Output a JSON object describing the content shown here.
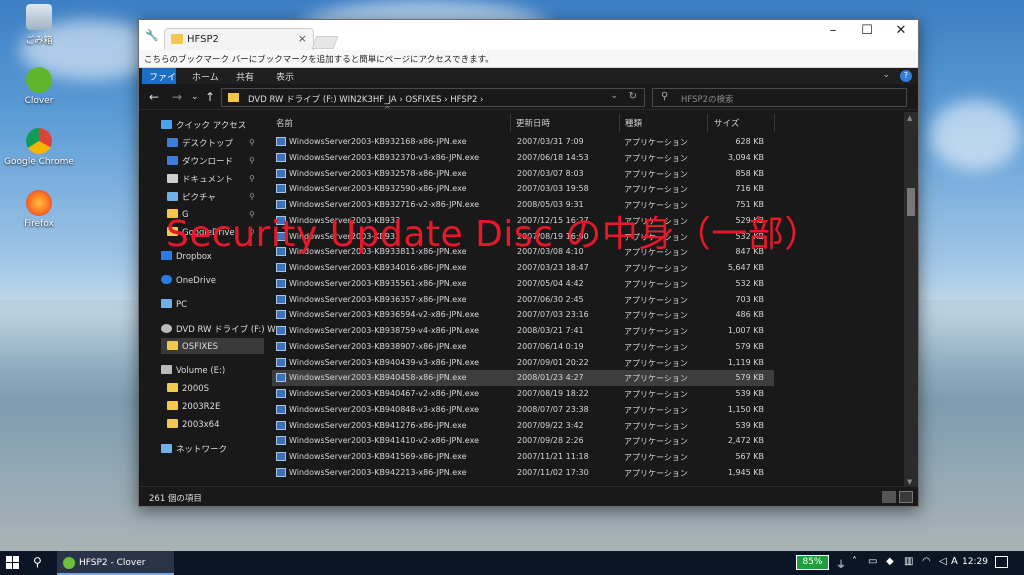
{
  "desktop": {
    "icons": [
      {
        "label": "ごみ箱"
      },
      {
        "label": "Clover"
      },
      {
        "label": "Google Chrome"
      },
      {
        "label": "Firefox"
      }
    ]
  },
  "window": {
    "tab_title": "HFSP2",
    "bookmark_bar_text": "こちらのブックマーク バーにブックマークを追加すると簡単にページにアクセスできます。",
    "ribbon": [
      "ファイル",
      "ホーム",
      "共有",
      "表示"
    ],
    "address_path": "DVD RW ドライブ (F:) WIN2K3HF_JA  ›  OSFIXES  ›  HFSP2  ›",
    "search_placeholder": "HFSP2の検索",
    "columns": {
      "name": "名前",
      "date": "更新日時",
      "type": "種類",
      "size": "サイズ"
    },
    "status_text": "261 個の項目",
    "overlay_text": "Security Update Disc の中身（一部）"
  },
  "sidebar": [
    {
      "label": "クイック アクセス",
      "color": "#4aa3f0",
      "pinned": false
    },
    {
      "label": "デスクトップ",
      "color": "#3b7dd8",
      "pinned": true
    },
    {
      "label": "ダウンロード",
      "color": "#3b7dd8",
      "pinned": true
    },
    {
      "label": "ドキュメント",
      "color": "#cfcfcf",
      "pinned": true
    },
    {
      "label": "ピクチャ",
      "color": "#6fb0e8",
      "pinned": true
    },
    {
      "label": "G",
      "color": "#f2c94c",
      "pinned": true
    },
    {
      "label": "GoogleDrive",
      "color": "#f2c94c",
      "pinned": true
    },
    {
      "label": "Dropbox",
      "color": "#2c7be5",
      "pinned": false
    },
    {
      "label": "OneDrive",
      "color": "#2c7be5",
      "pinned": false
    },
    {
      "label": "PC",
      "color": "#6fb0e8",
      "pinned": false
    },
    {
      "label": "DVD RW ドライブ (F:) W",
      "color": "#bbbbbb",
      "pinned": false
    },
    {
      "label": "OSFIXES",
      "color": "#f2c94c",
      "pinned": false
    },
    {
      "label": "Volume (E:)",
      "color": "#bbbbbb",
      "pinned": false
    },
    {
      "label": "2000S",
      "color": "#f2c94c",
      "pinned": false
    },
    {
      "label": "2003R2E",
      "color": "#f2c94c",
      "pinned": false
    },
    {
      "label": "2003x64",
      "color": "#f2c94c",
      "pinned": false
    },
    {
      "label": "ネットワーク",
      "color": "#6fb0e8",
      "pinned": false
    }
  ],
  "files": [
    {
      "name": "WindowsServer2003-KB932168-x86-JPN.exe",
      "date": "2007/03/31 7:09",
      "type": "アプリケーション",
      "size": "628 KB"
    },
    {
      "name": "WindowsServer2003-KB932370-v3-x86-JPN.exe",
      "date": "2007/06/18 14:53",
      "type": "アプリケーション",
      "size": "3,094 KB"
    },
    {
      "name": "WindowsServer2003-KB932578-x86-JPN.exe",
      "date": "2007/03/07 8:03",
      "type": "アプリケーション",
      "size": "858 KB"
    },
    {
      "name": "WindowsServer2003-KB932590-x86-JPN.exe",
      "date": "2007/03/03 19:58",
      "type": "アプリケーション",
      "size": "716 KB"
    },
    {
      "name": "WindowsServer2003-KB932716-v2-x86-JPN.exe",
      "date": "2008/05/03 9:31",
      "type": "アプリケーション",
      "size": "751 KB"
    },
    {
      "name": "WindowsServer2003-KB933",
      "date": "2007/12/15 16:27",
      "type": "アプリケーション",
      "size": "529 KB"
    },
    {
      "name": "WindowsServer2003-KB933",
      "date": "2007/08/19 16:00",
      "type": "アプリケーション",
      "size": "532 KB"
    },
    {
      "name": "WindowsServer2003-KB933811-x86-JPN.exe",
      "date": "2007/03/08 4:10",
      "type": "アプリケーション",
      "size": "847 KB"
    },
    {
      "name": "WindowsServer2003-KB934016-x86-JPN.exe",
      "date": "2007/03/23 18:47",
      "type": "アプリケーション",
      "size": "5,647 KB"
    },
    {
      "name": "WindowsServer2003-KB935561-x86-JPN.exe",
      "date": "2007/05/04 4:42",
      "type": "アプリケーション",
      "size": "532 KB"
    },
    {
      "name": "WindowsServer2003-KB936357-x86-JPN.exe",
      "date": "2007/06/30 2:45",
      "type": "アプリケーション",
      "size": "703 KB"
    },
    {
      "name": "WindowsServer2003-KB936594-v2-x86-JPN.exe",
      "date": "2007/07/03 23:16",
      "type": "アプリケーション",
      "size": "486 KB"
    },
    {
      "name": "WindowsServer2003-KB938759-v4-x86-JPN.exe",
      "date": "2008/03/21 7:41",
      "type": "アプリケーション",
      "size": "1,007 KB"
    },
    {
      "name": "WindowsServer2003-KB938907-x86-JPN.exe",
      "date": "2007/06/14 0:19",
      "type": "アプリケーション",
      "size": "579 KB"
    },
    {
      "name": "WindowsServer2003-KB940439-v3-x86-JPN.exe",
      "date": "2007/09/01 20:22",
      "type": "アプリケーション",
      "size": "1,119 KB"
    },
    {
      "name": "WindowsServer2003-KB940458-x86-JPN.exe",
      "date": "2008/01/23 4:27",
      "type": "アプリケーション",
      "size": "579 KB",
      "selected": true
    },
    {
      "name": "WindowsServer2003-KB940467-v2-x86-JPN.exe",
      "date": "2007/08/19 18:22",
      "type": "アプリケーション",
      "size": "539 KB"
    },
    {
      "name": "WindowsServer2003-KB940848-v3-x86-JPN.exe",
      "date": "2008/07/07 23:38",
      "type": "アプリケーション",
      "size": "1,150 KB"
    },
    {
      "name": "WindowsServer2003-KB941276-x86-JPN.exe",
      "date": "2007/09/22 3:42",
      "type": "アプリケーション",
      "size": "539 KB"
    },
    {
      "name": "WindowsServer2003-KB941410-v2-x86-JPN.exe",
      "date": "2007/09/28 2:26",
      "type": "アプリケーション",
      "size": "2,472 KB"
    },
    {
      "name": "WindowsServer2003-KB941569-x86-JPN.exe",
      "date": "2007/11/21 11:18",
      "type": "アプリケーション",
      "size": "567 KB"
    },
    {
      "name": "WindowsServer2003-KB942213-x86-JPN.exe",
      "date": "2007/11/02 17:30",
      "type": "アプリケーション",
      "size": "1,945 KB"
    }
  ],
  "taskbar": {
    "app_label": "HFSP2 - Clover",
    "battery": "85%",
    "clock": "12:29",
    "ime": "A"
  }
}
